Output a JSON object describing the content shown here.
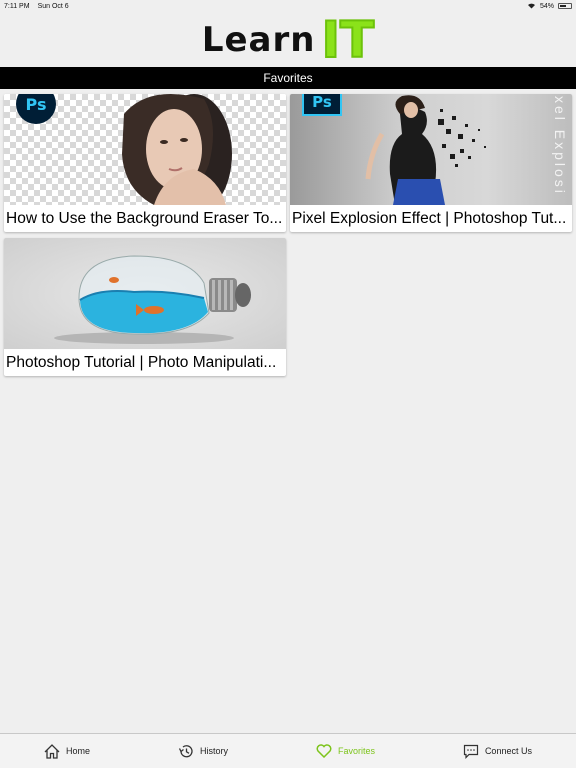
{
  "status_bar": {
    "time": "7:11 PM",
    "date": "Sun Oct 6",
    "battery": "54%"
  },
  "header": {
    "logo_part1": "Learn",
    "logo_part2": "IT"
  },
  "title_bar": {
    "title": "Favorites"
  },
  "cards": [
    {
      "title": "How to Use the Background Eraser To...",
      "badge": "Ps"
    },
    {
      "title": "Pixel Explosion Effect | Photoshop Tut...",
      "badge": "Ps",
      "overlay_text": "xel Explosi"
    },
    {
      "title": "Photoshop Tutorial | Photo Manipulati..."
    }
  ],
  "tab_bar": {
    "tabs": [
      {
        "label": "Home",
        "icon": "home-icon"
      },
      {
        "label": "History",
        "icon": "history-icon"
      },
      {
        "label": "Favorites",
        "icon": "heart-icon",
        "active": true
      },
      {
        "label": "Connect Us",
        "icon": "chat-icon"
      }
    ]
  },
  "colors": {
    "accent": "#7dc41c",
    "title_bar": "#000000",
    "background": "#efefef"
  }
}
